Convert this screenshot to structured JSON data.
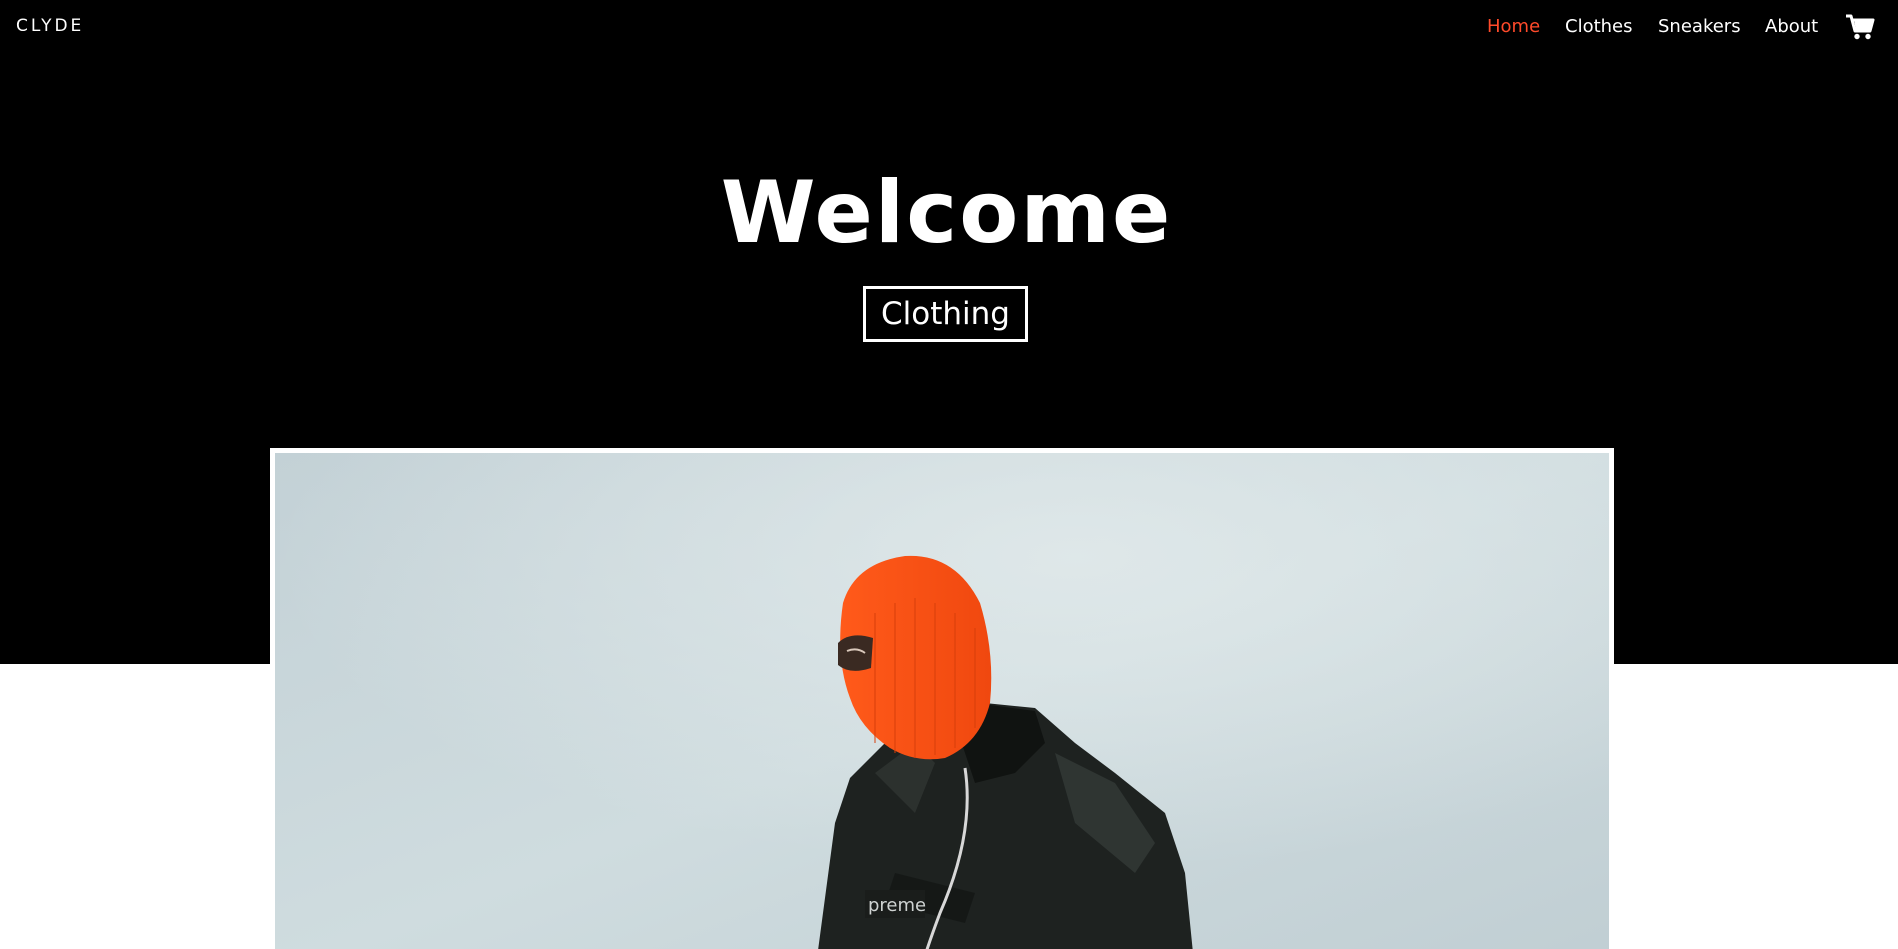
{
  "brand": {
    "name": "CLYDE"
  },
  "nav": {
    "items": [
      {
        "label": "Home",
        "active": true
      },
      {
        "label": "Clothes",
        "active": false
      },
      {
        "label": "Sneakers",
        "active": false
      },
      {
        "label": "About",
        "active": false
      }
    ],
    "cart_icon": "shopping-cart-icon"
  },
  "hero": {
    "title": "Welcome",
    "button_label": "Clothing"
  },
  "colors": {
    "background": "#000000",
    "text": "#ffffff",
    "accent": "#ff4a2a"
  }
}
